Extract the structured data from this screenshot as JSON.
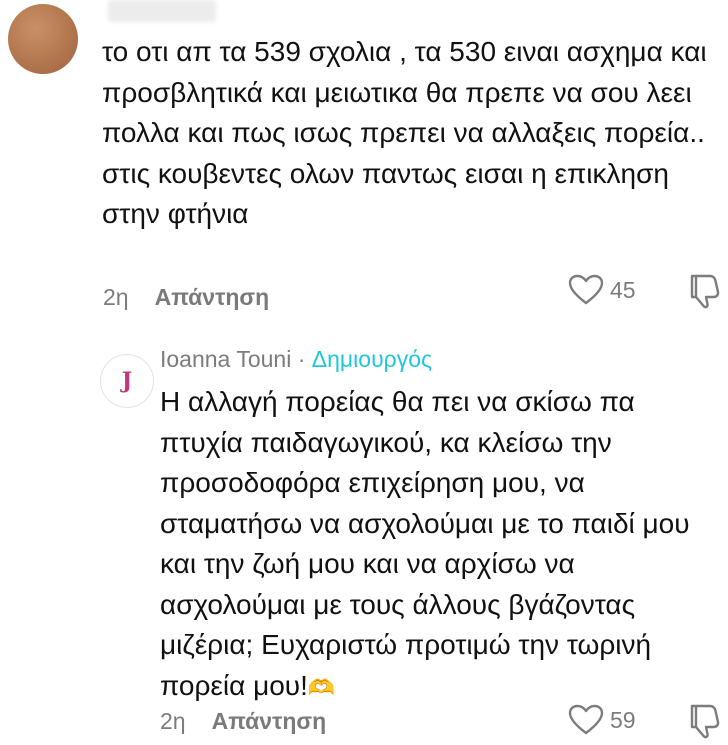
{
  "comment": {
    "text": "το οτι απ τα 539 σχολια , τα 530 ειναι ασχημα και προσβλητικά και μειωτικα θα πρεπε να σου λεει πολλα και πως ισως πρεπει να αλλαξεις πορεία.. στις κουβεντες ολων παντως εισαι η επικληση στην φτήνια",
    "time": "2η",
    "reply_label": "Απάντηση",
    "likes": "45"
  },
  "reply": {
    "avatar_letter": "J",
    "author": "Ioanna Touni",
    "separator": " · ",
    "badge": "Δημιουργός",
    "text": "Η αλλαγή πορείας θα πει να σκίσω πα πτυχία παιδαγωγικού, κα κλείσω την προσοδοφόρα επιχείρηση μου, να σταματήσω να ασχολούμαι με το παιδί μου και την ζωή μου και να αρχίσω να ασχολούμαι με τους άλλους βγάζοντας μιζέρια; Ευχαριστώ προτιμώ την τωρινή πορεία μου!",
    "emoji": "🫶",
    "time": "2η",
    "reply_label": "Απάντηση",
    "likes": "59"
  },
  "colors": {
    "creator_badge": "#20c7d8",
    "meta_gray": "#7c7c7c"
  },
  "icons": [
    "heart-outline-icon",
    "dislike-icon"
  ]
}
